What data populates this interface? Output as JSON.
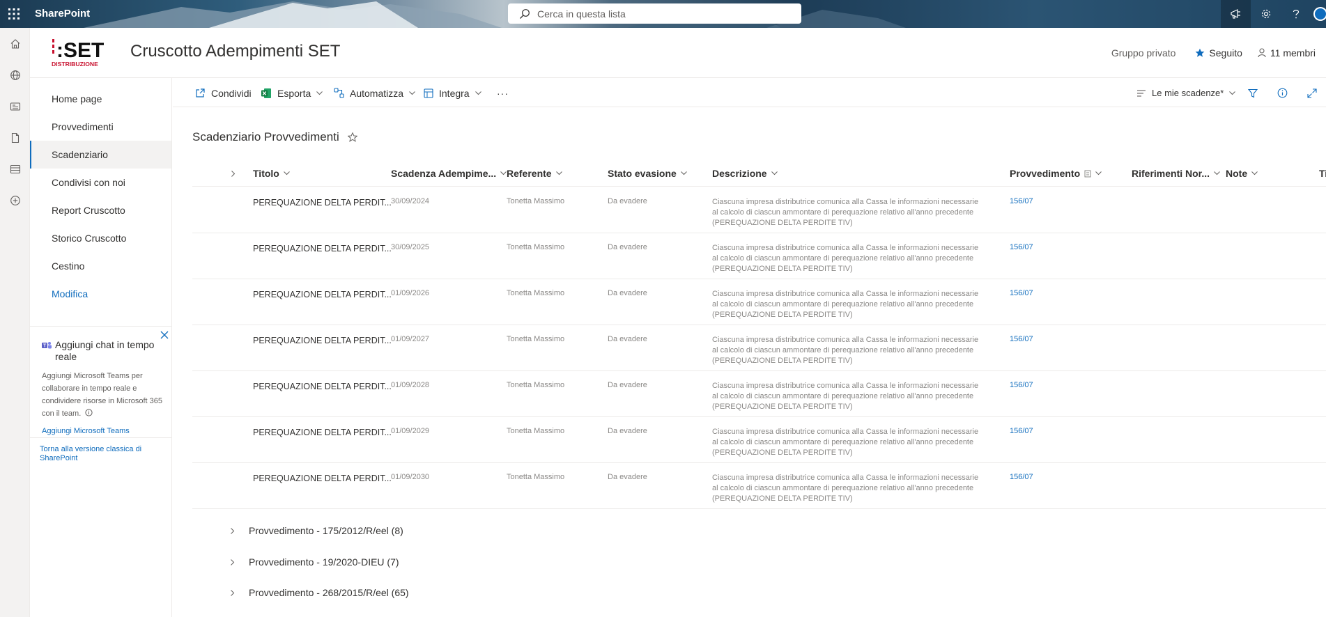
{
  "suite": {
    "brand": "SharePoint",
    "search_placeholder": "Cerca in questa lista"
  },
  "site": {
    "logo_main": ":SET",
    "logo_sub": "DISTRIBUZIONE",
    "title": "Cruscotto Adempimenti SET",
    "privacy": "Gruppo privato",
    "follow": "Seguito",
    "members": "11 membri"
  },
  "nav": {
    "items": [
      {
        "label": "Home page"
      },
      {
        "label": "Provvedimenti"
      },
      {
        "label": "Scadenziario"
      },
      {
        "label": "Condivisi con noi"
      },
      {
        "label": "Report Cruscotto"
      },
      {
        "label": "Storico Cruscotto"
      },
      {
        "label": "Cestino"
      },
      {
        "label": "Modifica"
      }
    ],
    "teams_title": "Aggiungi chat in tempo reale",
    "teams_desc": "Aggiungi Microsoft Teams per collaborare in tempo reale e condividere risorse in Microsoft 365 con il team.",
    "teams_link": "Aggiungi Microsoft Teams",
    "classic": "Torna alla versione classica di SharePoint"
  },
  "commands": {
    "share": "Condividi",
    "export": "Esporta",
    "automate": "Automatizza",
    "integrate": "Integra",
    "more": "···",
    "view": "Le mie scadenze*"
  },
  "list": {
    "title": "Scadenziario Provvedimenti",
    "columns": {
      "title": "Titolo",
      "deadline": "Scadenza Adempime...",
      "referent": "Referente",
      "status": "Stato evasione",
      "description": "Descrizione",
      "measure": "Provvedimento",
      "refs": "Riferimenti Nor...",
      "notes": "Note",
      "extra": "Ti"
    },
    "rows": [
      {
        "title": "PEREQUAZIONE DELTA PERDIT...",
        "deadline": "30/09/2024",
        "referent": "Tonetta Massimo",
        "status": "Da evadere",
        "description": "Ciascuna impresa distributrice comunica alla Cassa le informazioni necessarie al calcolo di ciascun ammontare di perequazione relativo all'anno precedente (PEREQUAZIONE DELTA PERDITE TIV)",
        "measure": "156/07"
      },
      {
        "title": "PEREQUAZIONE DELTA PERDIT...",
        "deadline": "30/09/2025",
        "referent": "Tonetta Massimo",
        "status": "Da evadere",
        "description": "Ciascuna impresa distributrice comunica alla Cassa le informazioni necessarie al calcolo di ciascun ammontare di perequazione relativo all'anno precedente (PEREQUAZIONE DELTA PERDITE TIV)",
        "measure": "156/07"
      },
      {
        "title": "PEREQUAZIONE DELTA PERDIT...",
        "deadline": "01/09/2026",
        "referent": "Tonetta Massimo",
        "status": "Da evadere",
        "description": "Ciascuna impresa distributrice comunica alla Cassa le informazioni necessarie al calcolo di ciascun ammontare di perequazione relativo all'anno precedente (PEREQUAZIONE DELTA PERDITE TIV)",
        "measure": "156/07"
      },
      {
        "title": "PEREQUAZIONE DELTA PERDIT...",
        "deadline": "01/09/2027",
        "referent": "Tonetta Massimo",
        "status": "Da evadere",
        "description": "Ciascuna impresa distributrice comunica alla Cassa le informazioni necessarie al calcolo di ciascun ammontare di perequazione relativo all'anno precedente (PEREQUAZIONE DELTA PERDITE TIV)",
        "measure": "156/07"
      },
      {
        "title": "PEREQUAZIONE DELTA PERDIT...",
        "deadline": "01/09/2028",
        "referent": "Tonetta Massimo",
        "status": "Da evadere",
        "description": "Ciascuna impresa distributrice comunica alla Cassa le informazioni necessarie al calcolo di ciascun ammontare di perequazione relativo all'anno precedente (PEREQUAZIONE DELTA PERDITE TIV)",
        "measure": "156/07"
      },
      {
        "title": "PEREQUAZIONE DELTA PERDIT...",
        "deadline": "01/09/2029",
        "referent": "Tonetta Massimo",
        "status": "Da evadere",
        "description": "Ciascuna impresa distributrice comunica alla Cassa le informazioni necessarie al calcolo di ciascun ammontare di perequazione relativo all'anno precedente (PEREQUAZIONE DELTA PERDITE TIV)",
        "measure": "156/07"
      },
      {
        "title": "PEREQUAZIONE DELTA PERDIT...",
        "deadline": "01/09/2030",
        "referent": "Tonetta Massimo",
        "status": "Da evadere",
        "description": "Ciascuna impresa distributrice comunica alla Cassa le informazioni necessarie al calcolo di ciascun ammontare di perequazione relativo all'anno precedente (PEREQUAZIONE DELTA PERDITE TIV)",
        "measure": "156/07"
      }
    ],
    "groups": [
      {
        "label": "Provvedimento - 175/2012/R/eel (8)"
      },
      {
        "label": "Provvedimento - 19/2020-DIEU (7)"
      },
      {
        "label": "Provvedimento - 268/2015/R/eel (65)"
      }
    ]
  }
}
